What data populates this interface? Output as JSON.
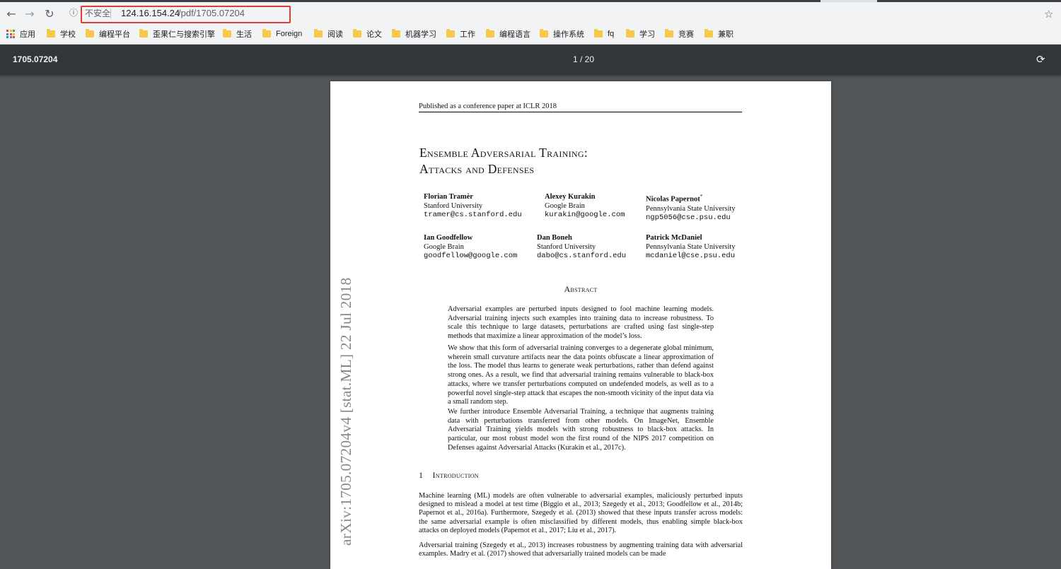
{
  "browser": {
    "url_not_secure": "不安全",
    "url_host": "124.16.154.24",
    "url_path": "/pdf/1705.07204",
    "icons": [
      "back-icon",
      "forward-icon",
      "reload-icon",
      "info-icon",
      "star-icon"
    ]
  },
  "bookmarks": {
    "apps_label": "应用",
    "items": [
      "学校",
      "编程平台",
      "歪果仁与搜索引擎",
      "生活",
      "Foreign",
      "阅读",
      "论文",
      "机器学习",
      "工作",
      "编程语言",
      "操作系统",
      "fq",
      "学习",
      "竞赛",
      "兼职"
    ],
    "folder_color": "#f7c948"
  },
  "pdf_viewer": {
    "title": "1705.07204",
    "page_indicator": "1 / 20"
  },
  "paper": {
    "header": "Published as a conference paper at ICLR 2018",
    "title_line1": "Ensemble Adversarial Training:",
    "title_line2": "Attacks and Defenses",
    "authors": [
      {
        "name": "Florian Tramèr",
        "affiliation": "Stanford University",
        "email": "tramer@cs.stanford.edu"
      },
      {
        "name": "Alexey Kurakin",
        "affiliation": "Google Brain",
        "email": "kurakin@google.com"
      },
      {
        "name": "Nicolas Papernot",
        "affiliation": "Pennsylvania State University",
        "email": "ngp5056@cse.psu.edu"
      },
      {
        "name": "Ian Goodfellow",
        "affiliation": "Google Brain",
        "email": "goodfellow@google.com"
      },
      {
        "name": "Dan Boneh",
        "affiliation": "Stanford University",
        "email": "dabo@cs.stanford.edu"
      },
      {
        "name": "Patrick McDaniel",
        "affiliation": "Pennsylvania State University",
        "email": "mcdaniel@cse.psu.edu"
      }
    ],
    "abstract_heading": "Abstract",
    "abstract_p1": "Adversarial examples are perturbed inputs designed to fool machine learning models. Adversarial training injects such examples into training data to increase robustness. To scale this technique to large datasets, perturbations are crafted using fast single-step methods that maximize a linear approximation of the model’s loss.",
    "abstract_p2": "We show that this form of adversarial training converges to a degenerate global minimum, wherein small curvature artifacts near the data points obfuscate a linear approximation of the loss. The model thus learns to generate weak perturbations, rather than defend against strong ones. As a result, we find that adversarial training remains vulnerable to black-box attacks, where we transfer perturbations computed on undefended models, as well as to a powerful novel single-step attack that escapes the non-smooth vicinity of the input data via a small random step.",
    "abstract_p3": "We further introduce Ensemble Adversarial Training, a technique that augments training data with perturbations transferred from other models. On ImageNet, Ensemble Adversarial Training yields models with strong robustness to black-box attacks. In particular, our most robust model won the first round of the NIPS 2017 competition on Defenses against Adversarial Attacks (Kurakin et al., 2017c).",
    "section_number": "1",
    "section_title": "Introduction",
    "intro_p1": "Machine learning (ML) models are often vulnerable to adversarial examples, maliciously perturbed inputs designed to mislead a model at test time (Biggio et al., 2013; Szegedy et al., 2013; Goodfellow et al., 2014b; Papernot et al., 2016a). Furthermore, Szegedy et al. (2013) showed that these inputs transfer across models: the same adversarial example is often misclassified by different models, thus enabling simple black-box attacks on deployed models (Papernot et al., 2017; Liu et al., 2017).",
    "intro_p2": "Adversarial training (Szegedy et al., 2013) increases robustness by augmenting training data with adversarial examples. Madry et al. (2017) showed that adversarially trained models can be made",
    "arxiv_stamp": "arXiv:1705.07204v4  [stat.ML]  22 Jul 2018"
  }
}
